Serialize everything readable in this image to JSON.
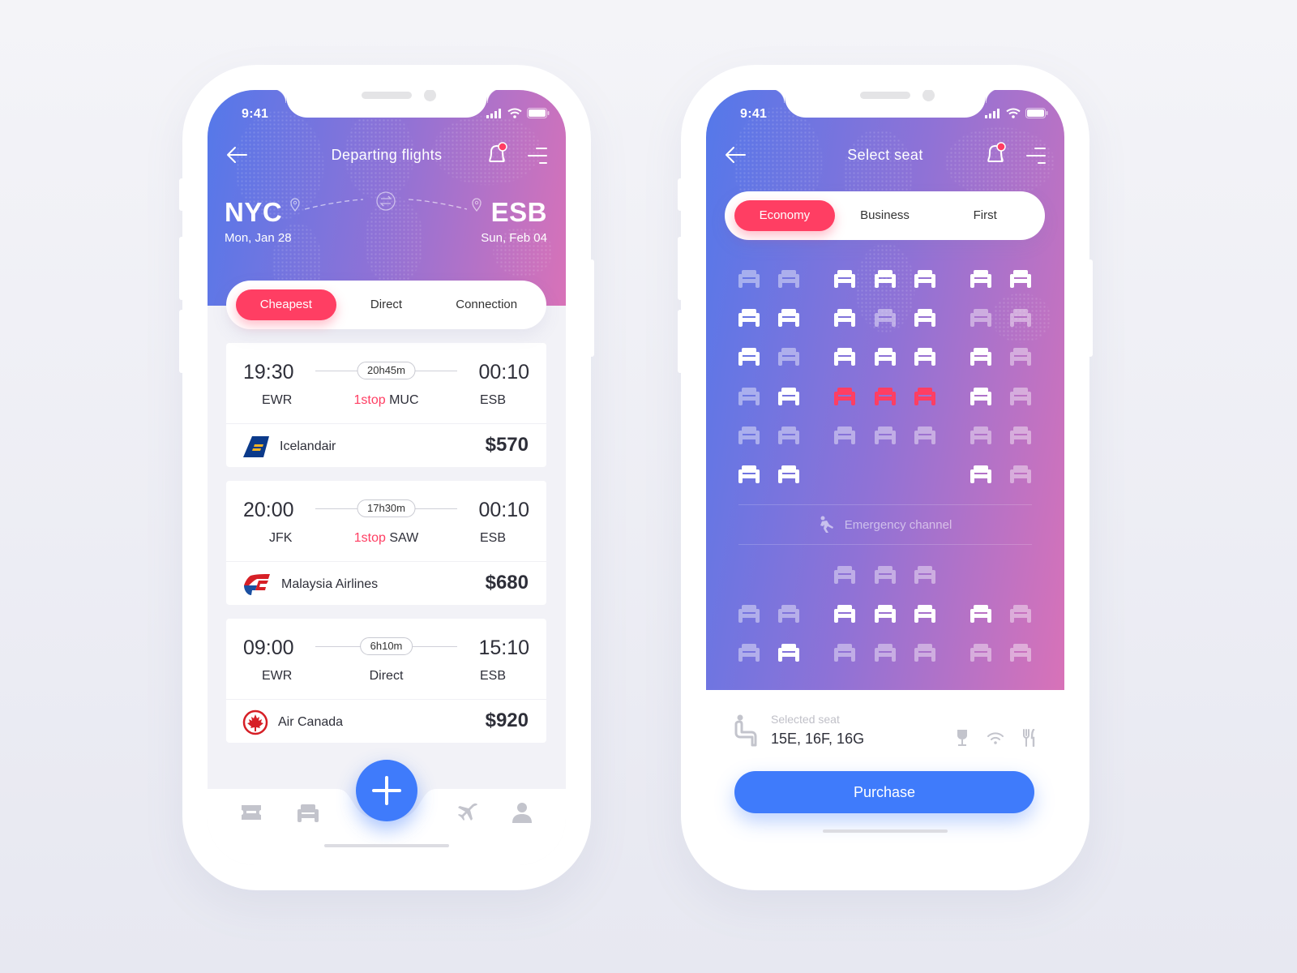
{
  "colors": {
    "accent_red": "#ff3e63",
    "accent_blue": "#3f7bfb",
    "gradient_start": "#5478ea",
    "gradient_end": "#d872b8",
    "text_dark": "#2e2f39",
    "icon_gray": "#c3c4cc"
  },
  "flights_screen": {
    "status": {
      "time": "9:41",
      "icons": [
        "signal-icon",
        "wifi-icon",
        "battery-icon"
      ]
    },
    "nav": {
      "title": "Departing flights",
      "back_icon": "arrow-left-icon",
      "bell_icon": "bell-icon",
      "menu_icon": "menu-icon",
      "has_notification": true
    },
    "route": {
      "from": {
        "code": "NYC",
        "date": "Mon, Jan 28"
      },
      "to": {
        "code": "ESB",
        "date": "Sun, Feb 04"
      },
      "swap_icon": "swap-icon"
    },
    "tabs": [
      {
        "label": "Cheapest",
        "active": true
      },
      {
        "label": "Direct",
        "active": false
      },
      {
        "label": "Connection",
        "active": false
      }
    ],
    "flights": [
      {
        "depart_time": "19:30",
        "depart_airport": "EWR",
        "duration": "20h45m",
        "stops_label": "1stop",
        "via": "MUC",
        "arrive_time": "00:10",
        "arrive_airport": "ESB",
        "airline": "Icelandair",
        "logo": "icelandair-logo",
        "price": "$570"
      },
      {
        "depart_time": "20:00",
        "depart_airport": "JFK",
        "duration": "17h30m",
        "stops_label": "1stop",
        "via": "SAW",
        "arrive_time": "00:10",
        "arrive_airport": "ESB",
        "airline": "Malaysia Airlines",
        "logo": "malaysia-airlines-logo",
        "price": "$680"
      },
      {
        "depart_time": "09:00",
        "depart_airport": "EWR",
        "duration": "6h10m",
        "stops_label": "",
        "via": "Direct",
        "arrive_time": "15:10",
        "arrive_airport": "ESB",
        "airline": "Air Canada",
        "logo": "air-canada-logo",
        "price": "$920"
      }
    ],
    "tabbar": {
      "items": [
        "ticket-icon",
        "seat-icon",
        "add-button",
        "plane-icon",
        "profile-icon"
      ]
    }
  },
  "seat_screen": {
    "status": {
      "time": "9:41"
    },
    "nav": {
      "title": "Select seat",
      "has_notification": true
    },
    "classes": [
      {
        "label": "Economy",
        "active": true
      },
      {
        "label": "Business",
        "active": false
      },
      {
        "label": "First",
        "active": false
      }
    ],
    "seat_legend": {
      "A": "available",
      "T": "taken",
      "S": "selected",
      "-": "no seat"
    },
    "seat_rows_front": [
      "TT|AAA|AA",
      "AA|ATA|TT",
      "AT|AAA|AT",
      "TA|SSS|AT",
      "TT|TTT|TT",
      "AA|---|AT"
    ],
    "emergency_label": "Emergency channel",
    "seat_rows_back": [
      "--|TTT|--",
      "TT|AAA|AT",
      "TA|TTT|TT"
    ],
    "selection": {
      "label": "Selected seat",
      "value": "15E, 16F, 16G",
      "amenities": [
        "drink-icon",
        "wifi-icon",
        "meal-icon"
      ]
    },
    "purchase_label": "Purchase"
  }
}
